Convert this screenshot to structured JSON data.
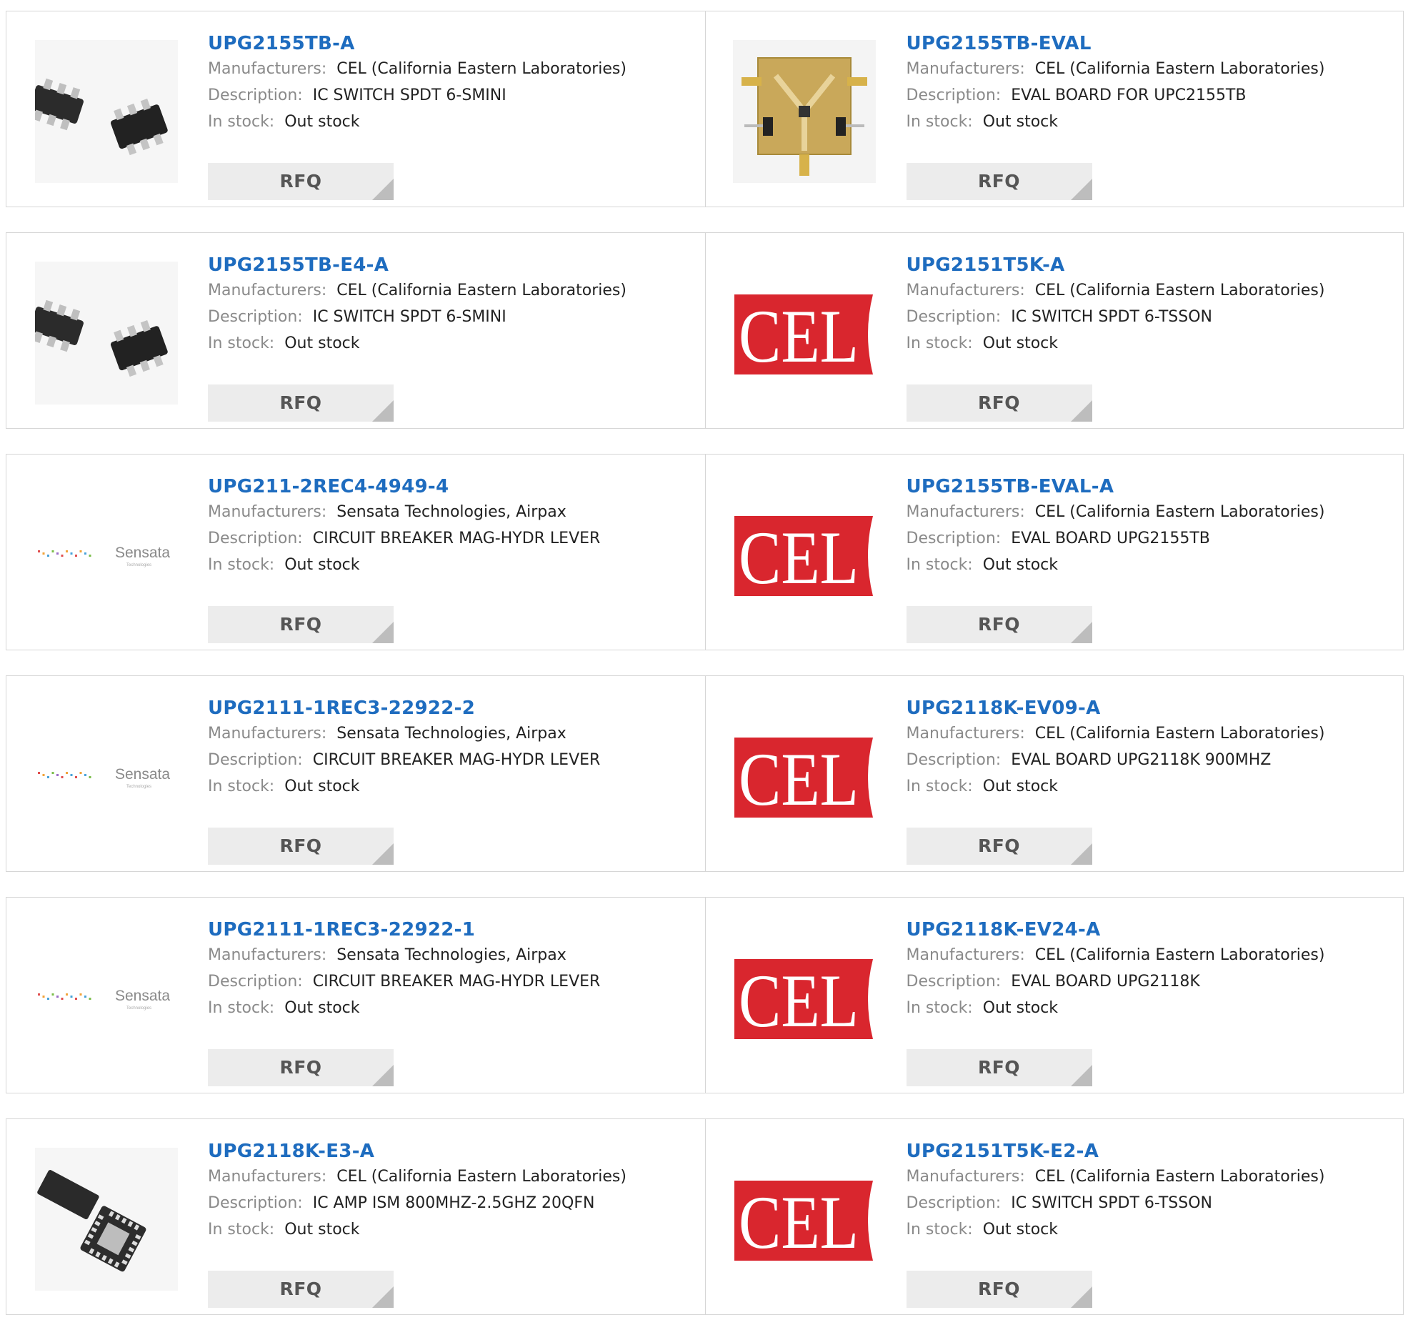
{
  "labels": {
    "manufacturers": "Manufacturers:",
    "description": "Description:",
    "in_stock": "In stock:",
    "rfq": "RFQ"
  },
  "products": [
    {
      "part": "UPG2155TB-A",
      "manufacturer": "CEL (California Eastern Laboratories)",
      "description": "IC SWITCH SPDT 6-SMINI",
      "stock": "Out stock",
      "image": "sot-chip-image"
    },
    {
      "part": "UPG2155TB-EVAL",
      "manufacturer": "CEL (California Eastern Laboratories)",
      "description": "EVAL BOARD FOR UPC2155TB",
      "stock": "Out stock",
      "image": "eval-board-image"
    },
    {
      "part": "UPG2155TB-E4-A",
      "manufacturer": "CEL (California Eastern Laboratories)",
      "description": "IC SWITCH SPDT 6-SMINI",
      "stock": "Out stock",
      "image": "sot-chip-image"
    },
    {
      "part": "UPG2151T5K-A",
      "manufacturer": "CEL (California Eastern Laboratories)",
      "description": "IC SWITCH SPDT 6-TSSON",
      "stock": "Out stock",
      "image": "cel-logo"
    },
    {
      "part": "UPG211-2REC4-4949-4",
      "manufacturer": "Sensata Technologies, Airpax",
      "description": "CIRCUIT BREAKER MAG-HYDR LEVER",
      "stock": "Out stock",
      "image": "sensata-logo"
    },
    {
      "part": "UPG2155TB-EVAL-A",
      "manufacturer": "CEL (California Eastern Laboratories)",
      "description": "EVAL BOARD UPG2155TB",
      "stock": "Out stock",
      "image": "cel-logo"
    },
    {
      "part": "UPG2111-1REC3-22922-2",
      "manufacturer": "Sensata Technologies, Airpax",
      "description": "CIRCUIT BREAKER MAG-HYDR LEVER",
      "stock": "Out stock",
      "image": "sensata-logo"
    },
    {
      "part": "UPG2118K-EV09-A",
      "manufacturer": "CEL (California Eastern Laboratories)",
      "description": "EVAL BOARD UPG2118K 900MHZ",
      "stock": "Out stock",
      "image": "cel-logo"
    },
    {
      "part": "UPG2111-1REC3-22922-1",
      "manufacturer": "Sensata Technologies, Airpax",
      "description": "CIRCUIT BREAKER MAG-HYDR LEVER",
      "stock": "Out stock",
      "image": "sensata-logo"
    },
    {
      "part": "UPG2118K-EV24-A",
      "manufacturer": "CEL (California Eastern Laboratories)",
      "description": "EVAL BOARD UPG2118K",
      "stock": "Out stock",
      "image": "cel-logo"
    },
    {
      "part": "UPG2118K-E3-A",
      "manufacturer": "CEL (California Eastern Laboratories)",
      "description": "IC AMP ISM 800MHZ-2.5GHZ 20QFN",
      "stock": "Out stock",
      "image": "qfn-chip-image"
    },
    {
      "part": "UPG2151T5K-E2-A",
      "manufacturer": "CEL (California Eastern Laboratories)",
      "description": "IC SWITCH SPDT 6-TSSON",
      "stock": "Out stock",
      "image": "cel-logo"
    }
  ],
  "logos": {
    "cel_text": "CEL",
    "sensata_text": "Sensata",
    "sensata_sub": "Technologies"
  },
  "colors": {
    "link": "#1e6cbf",
    "cel_red": "#d9262e",
    "rfq_bg": "#ececec",
    "border": "#d6d6d6"
  }
}
